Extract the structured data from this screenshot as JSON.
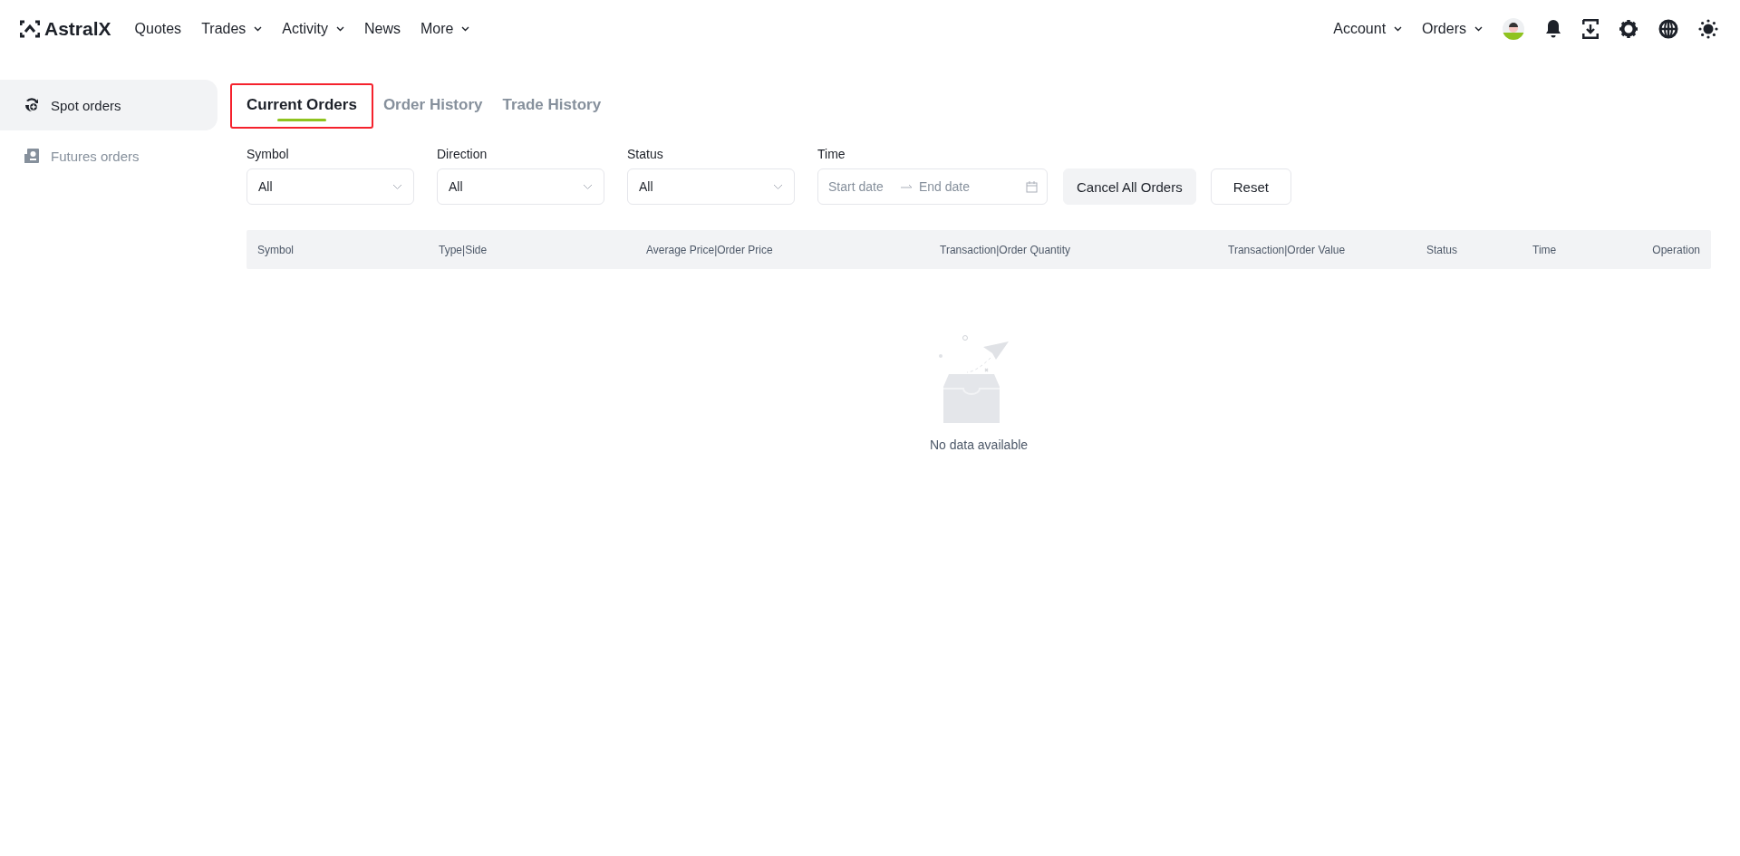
{
  "brand": {
    "name": "AstralX"
  },
  "nav": [
    {
      "label": "Quotes",
      "has_menu": false
    },
    {
      "label": "Trades",
      "has_menu": true
    },
    {
      "label": "Activity",
      "has_menu": true
    },
    {
      "label": "News",
      "has_menu": false
    },
    {
      "label": "More",
      "has_menu": true
    }
  ],
  "header_right": [
    {
      "label": "Account",
      "has_menu": true
    },
    {
      "label": "Orders",
      "has_menu": true
    }
  ],
  "header_icons": [
    {
      "kind": "avatar"
    },
    {
      "kind": "bell"
    },
    {
      "kind": "download"
    },
    {
      "kind": "settings"
    },
    {
      "kind": "globe"
    },
    {
      "kind": "sun"
    }
  ],
  "sidebar": {
    "items": [
      {
        "label": "Spot orders",
        "kind": "spot",
        "selected": true
      },
      {
        "label": "Futures orders",
        "kind": "futures",
        "selected": false
      }
    ]
  },
  "tabs": [
    {
      "label": "Current Orders",
      "selected": true,
      "highlighted": true
    },
    {
      "label": "Order History",
      "selected": false,
      "highlighted": false
    },
    {
      "label": "Trade History",
      "selected": false,
      "highlighted": false
    }
  ],
  "filters": [
    {
      "label": "Symbol",
      "kind": "select",
      "value": "All"
    },
    {
      "label": "Direction",
      "kind": "select",
      "value": "All"
    },
    {
      "label": "Status",
      "kind": "select",
      "value": "All"
    },
    {
      "label": "Time",
      "kind": "daterange",
      "start_placeholder": "Start date",
      "end_placeholder": "End date"
    }
  ],
  "buttons": [
    {
      "label": "Cancel All Orders",
      "kind": "filled"
    },
    {
      "label": "Reset",
      "kind": "outline"
    }
  ],
  "table": {
    "columns": [
      "Symbol",
      "Type|Side",
      "Average Price|Order Price",
      "Transaction|Order Quantity",
      "Transaction|Order Value",
      "Status",
      "Time",
      "Operation"
    ],
    "empty_text": "No data available"
  }
}
